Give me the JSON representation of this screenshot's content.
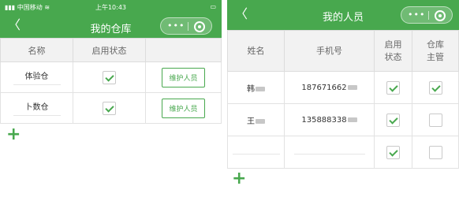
{
  "left": {
    "status": {
      "carrier": "中国移动",
      "time": "上午10:43",
      "battery": "▭"
    },
    "nav": {
      "back": "〈",
      "title": "我的仓库",
      "menu": "•••"
    },
    "columns": [
      "名称",
      "启用状态",
      ""
    ],
    "rows": [
      {
        "name": "体验仓",
        "enabled": true,
        "action": "维护人员"
      },
      {
        "name": "卜数仓",
        "enabled": true,
        "action": "维护人员"
      }
    ],
    "add": "+"
  },
  "right": {
    "nav": {
      "back": "〈",
      "title": "我的人员",
      "menu": "•••"
    },
    "columns": [
      "姓名",
      "手机号",
      "启用\n状态",
      "仓库\n主管"
    ],
    "rows": [
      {
        "name": "韩",
        "phone": "187671662",
        "enabled": true,
        "manager": true
      },
      {
        "name": "王",
        "phone": "135888338",
        "enabled": true,
        "manager": false
      },
      {
        "name": "",
        "phone": "",
        "enabled": true,
        "manager": false
      }
    ],
    "add": "+"
  },
  "colors": {
    "accent": "#48a84e",
    "header_bg": "#f2f2f2"
  },
  "icons": [
    "back-arrow-icon",
    "more-dots-icon",
    "close-circle-icon",
    "checkbox-icon",
    "plus-icon",
    "signal-icon",
    "wifi-icon",
    "battery-icon"
  ]
}
